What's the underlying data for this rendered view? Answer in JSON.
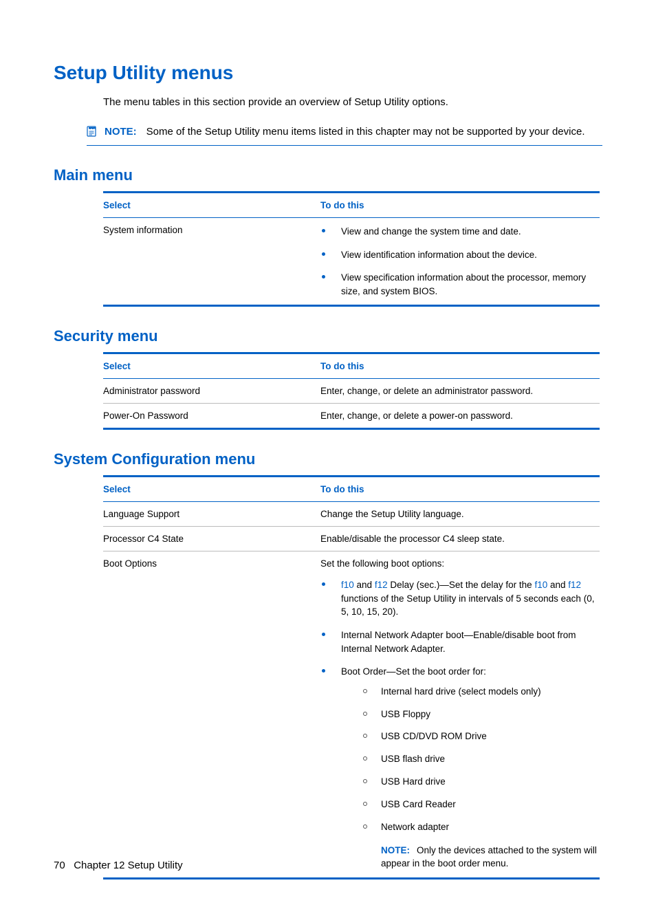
{
  "page_title": "Setup Utility menus",
  "intro": "The menu tables in this section provide an overview of Setup Utility options.",
  "top_note": {
    "label": "NOTE:",
    "text": "Some of the Setup Utility menu items listed in this chapter may not be supported by your device."
  },
  "table_headers": {
    "select": "Select",
    "action": "To do this"
  },
  "main_menu": {
    "title": "Main menu",
    "rows": [
      {
        "select": "System information",
        "bullets": [
          "View and change the system time and date.",
          "View identification information about the device.",
          "View specification information about the processor, memory size, and system BIOS."
        ]
      }
    ]
  },
  "security_menu": {
    "title": "Security menu",
    "rows": [
      {
        "select": "Administrator password",
        "action": "Enter, change, or delete an administrator password."
      },
      {
        "select": "Power-On Password",
        "action": "Enter, change, or delete a power-on password."
      }
    ]
  },
  "sysconfig_menu": {
    "title": "System Configuration menu",
    "rows": [
      {
        "select": "Language Support",
        "action": "Change the Setup Utility language."
      },
      {
        "select": "Processor C4 State",
        "action": "Enable/disable the processor C4 sleep state."
      }
    ],
    "boot": {
      "select": "Boot Options",
      "lead": "Set the following boot options:",
      "bullets": {
        "delay": {
          "f10": "f10",
          "mid1": " and ",
          "f12": "f12",
          "mid2": " Delay (sec.)—Set the delay for the ",
          "f10b": "f10",
          "mid3": " and ",
          "f12b": "f12",
          "tail": " functions of the Setup Utility in intervals of 5 seconds each (0, 5, 10, 15, 20)."
        },
        "network": "Internal Network Adapter boot—Enable/disable boot from Internal Network Adapter.",
        "order_lead": "Boot Order—Set the boot order for:",
        "order_items": [
          "Internal hard drive (select models only)",
          "USB Floppy",
          "USB CD/DVD ROM Drive",
          "USB flash drive",
          "USB Hard drive",
          "USB Card Reader",
          "Network adapter"
        ],
        "inner_note": {
          "label": "NOTE:",
          "text": "Only the devices attached to the system will appear in the boot order menu."
        }
      }
    }
  },
  "footer": {
    "page_no": "70",
    "chapter": "Chapter 12   Setup Utility"
  }
}
